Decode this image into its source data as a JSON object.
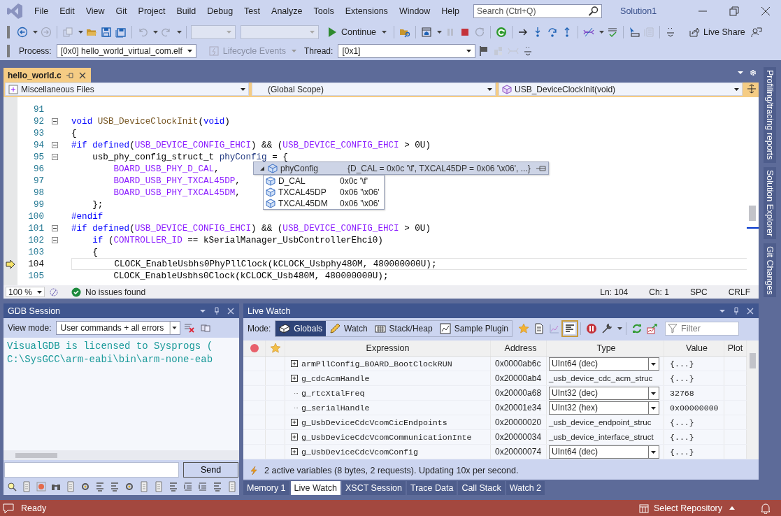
{
  "menu": {
    "items": [
      "File",
      "Edit",
      "View",
      "Git",
      "Project",
      "Build",
      "Debug",
      "Test",
      "Analyze",
      "Tools",
      "Extensions",
      "Window",
      "Help"
    ],
    "search": {
      "placeholder": "Search (Ctrl+Q)"
    },
    "solution": "Solution1"
  },
  "toolbar": {
    "continue": "Continue",
    "live_share": "Live Share"
  },
  "debug_bar": {
    "process_label": "Process:",
    "process": "[0x0] hello_world_virtual_com.elf",
    "lifecycle": {
      "label": "Lifecycle Events",
      "disabled": true
    },
    "thread_label": "Thread:",
    "thread": "[0x1]"
  },
  "editor": {
    "tabs": [
      {
        "label": "hello_world.c",
        "selected": true
      }
    ],
    "project": "Miscellaneous Files",
    "scope": "(Global Scope)",
    "member": "USB_DeviceClockInit(void)",
    "lines": [
      {
        "number": "91",
        "fold": false,
        "current": false
      },
      {
        "number": "92",
        "fold": true,
        "current": false,
        "segments": [
          {
            "text": "void",
            "kind": "keyword"
          },
          {
            "text": " USB_DeviceClockInit",
            "kind": "function"
          },
          {
            "text": "(",
            "kind": "plain"
          },
          {
            "text": "void",
            "kind": "keyword"
          },
          {
            "text": ")",
            "kind": "plain"
          }
        ]
      },
      {
        "number": "93",
        "fold": false,
        "current": false,
        "segments": [
          {
            "text": "{",
            "kind": "plain"
          }
        ]
      },
      {
        "number": "94",
        "fold": true,
        "current": false,
        "segments": [
          {
            "text": "#if",
            "kind": "keyword"
          },
          {
            "text": " defined",
            "kind": "keyword"
          },
          {
            "text": "(",
            "kind": "plain"
          },
          {
            "text": "USB_DEVICE_CONFIG_EHCI",
            "kind": "macro"
          },
          {
            "text": ") && (",
            "kind": "plain"
          },
          {
            "text": "USB_DEVICE_CONFIG_EHCI",
            "kind": "macro"
          },
          {
            "text": " > 0U)",
            "kind": "plain"
          }
        ]
      },
      {
        "number": "95",
        "fold": true,
        "current": false,
        "segments": [
          {
            "text": "    usb_phy_config_struct_t ",
            "kind": "plain"
          },
          {
            "text": "phyConfig",
            "kind": "local"
          },
          {
            "text": " = {",
            "kind": "plain"
          }
        ]
      },
      {
        "number": "96",
        "fold": false,
        "current": false,
        "segments": [
          {
            "text": "        BOARD_USB_PHY_D_CAL",
            "kind": "macro"
          },
          {
            "text": ",",
            "kind": "plain"
          }
        ]
      },
      {
        "number": "97",
        "fold": false,
        "current": false,
        "segments": [
          {
            "text": "        BOARD_USB_PHY_TXCAL45DP",
            "kind": "macro"
          },
          {
            "text": ",",
            "kind": "plain"
          }
        ]
      },
      {
        "number": "98",
        "fold": false,
        "current": false,
        "segments": [
          {
            "text": "        BOARD_USB_PHY_TXCAL45DM",
            "kind": "macro"
          },
          {
            "text": ",",
            "kind": "plain"
          }
        ]
      },
      {
        "number": "99",
        "fold": false,
        "current": false,
        "segments": [
          {
            "text": "    };",
            "kind": "plain"
          }
        ]
      },
      {
        "number": "100",
        "fold": false,
        "current": false,
        "segments": [
          {
            "text": "#endif",
            "kind": "keyword"
          }
        ]
      },
      {
        "number": "101",
        "fold": true,
        "current": false,
        "segments": [
          {
            "text": "#if",
            "kind": "keyword"
          },
          {
            "text": " defined",
            "kind": "keyword"
          },
          {
            "text": "(",
            "kind": "plain"
          },
          {
            "text": "USB_DEVICE_CONFIG_EHCI",
            "kind": "macro"
          },
          {
            "text": ") && (",
            "kind": "plain"
          },
          {
            "text": "USB_DEVICE_CONFIG_EHCI",
            "kind": "macro"
          },
          {
            "text": " > 0U)",
            "kind": "plain"
          }
        ]
      },
      {
        "number": "102",
        "fold": true,
        "current": false,
        "segments": [
          {
            "text": "    if",
            "kind": "keyword"
          },
          {
            "text": " (",
            "kind": "plain"
          },
          {
            "text": "CONTROLLER_ID",
            "kind": "macro"
          },
          {
            "text": " == kSerialManager_UsbControllerEhci0)",
            "kind": "plain"
          }
        ]
      },
      {
        "number": "103",
        "fold": false,
        "current": false,
        "segments": [
          {
            "text": "    {",
            "kind": "plain"
          }
        ]
      },
      {
        "number": "104",
        "fold": false,
        "current": true,
        "segments": [
          {
            "text": "        CLOCK_EnableUsbhs0PhyPllClock(kCLOCK_Usbphy480M, 480000000U);",
            "kind": "plain"
          }
        ]
      },
      {
        "number": "105",
        "fold": false,
        "current": false,
        "segments": [
          {
            "text": "        CLOCK_EnableUsbhs0Clock(kCLOCK_Usb480M, 480000000U);",
            "kind": "plain"
          }
        ]
      }
    ],
    "datatip": {
      "name": "phyConfig",
      "value": "{D_CAL = 0x0c '\\f', TXCAL45DP = 0x06 '\\x06', ...}",
      "expanded": true,
      "children": [
        {
          "name": "D_CAL",
          "value": "0x0c '\\f'"
        },
        {
          "name": "TXCAL45DP",
          "value": "0x06 '\\x06'"
        },
        {
          "name": "TXCAL45DM",
          "value": "0x06 '\\x06'"
        }
      ]
    },
    "status": {
      "zoom": "100 %",
      "issues": "No issues found",
      "ln": "Ln: 104",
      "ch": "Ch: 1",
      "indent": "SPC",
      "eol": "CRLF"
    }
  },
  "side_tabs": [
    "Profiling/tracing reports",
    "Solution Explorer",
    "Git Changes"
  ],
  "gdb": {
    "title": "GDB Session",
    "view_mode_label": "View mode:",
    "view_mode": "User commands + all errors",
    "output": [
      "VisualGDB is licensed to Sysprogs (",
      "C:\\SysGCC\\arm-eabi\\bin\\arm-none-eab"
    ],
    "send": "Send"
  },
  "live_watch": {
    "title": "Live Watch",
    "mode_label": "Mode:",
    "modes": [
      {
        "label": "Globals",
        "selected": true
      },
      {
        "label": "Watch",
        "selected": false
      },
      {
        "label": "Stack/Heap",
        "selected": false
      },
      {
        "label": "Sample Plugin",
        "selected": false
      }
    ],
    "filter_placeholder": "Filter",
    "columns": [
      "Expression",
      "Address",
      "Type",
      "Value",
      "Plot"
    ],
    "rows": [
      {
        "kind": "group",
        "expression": "armPllConfig_BOARD_BootClockRUN",
        "address": "0x0000ab6c",
        "type": "UInt64 (dec)",
        "type_editable": true,
        "value": "{...}"
      },
      {
        "kind": "group",
        "expression": "g_cdcAcmHandle",
        "address": "0x20000ab4",
        "type": "_usb_device_cdc_acm_struc",
        "type_editable": false,
        "value": "{...}"
      },
      {
        "kind": "leaf",
        "expression": "g_rtcXtalFreq",
        "address": "0x20000a68",
        "type": "UInt32 (dec)",
        "type_editable": true,
        "value": "32768"
      },
      {
        "kind": "leaf",
        "expression": "g_serialHandle",
        "address": "0x20001e34",
        "type": "UInt32 (hex)",
        "type_editable": true,
        "value": "0x00000000"
      },
      {
        "kind": "group",
        "expression": "g_UsbDeviceCdcVcomCicEndpoints",
        "address": "0x20000020",
        "type": "_usb_device_endpoint_struc",
        "type_editable": false,
        "value": "{...}"
      },
      {
        "kind": "group",
        "expression": "g_UsbDeviceCdcVcomCommunicationInte",
        "address": "0x20000034",
        "type": "_usb_device_interface_struct",
        "type_editable": false,
        "value": "{...}"
      },
      {
        "kind": "group",
        "expression": "g_UsbDeviceCdcVcomConfig",
        "address": "0x20000074",
        "type": "UInt64 (dec)",
        "type_editable": true,
        "value": "{...}"
      }
    ],
    "status": "2 active variables (8 bytes, 2 requests). Updating 10x per second."
  },
  "bottom_tabs": [
    {
      "label": "Memory 1",
      "selected": false
    },
    {
      "label": "Live Watch",
      "selected": true
    },
    {
      "label": "XSCT Session",
      "selected": false
    },
    {
      "label": "Trace Data",
      "selected": false
    },
    {
      "label": "Call Stack",
      "selected": false
    },
    {
      "label": "Watch 2",
      "selected": false
    }
  ],
  "status_bar": {
    "text": "Ready",
    "repository": "Select Repository"
  }
}
